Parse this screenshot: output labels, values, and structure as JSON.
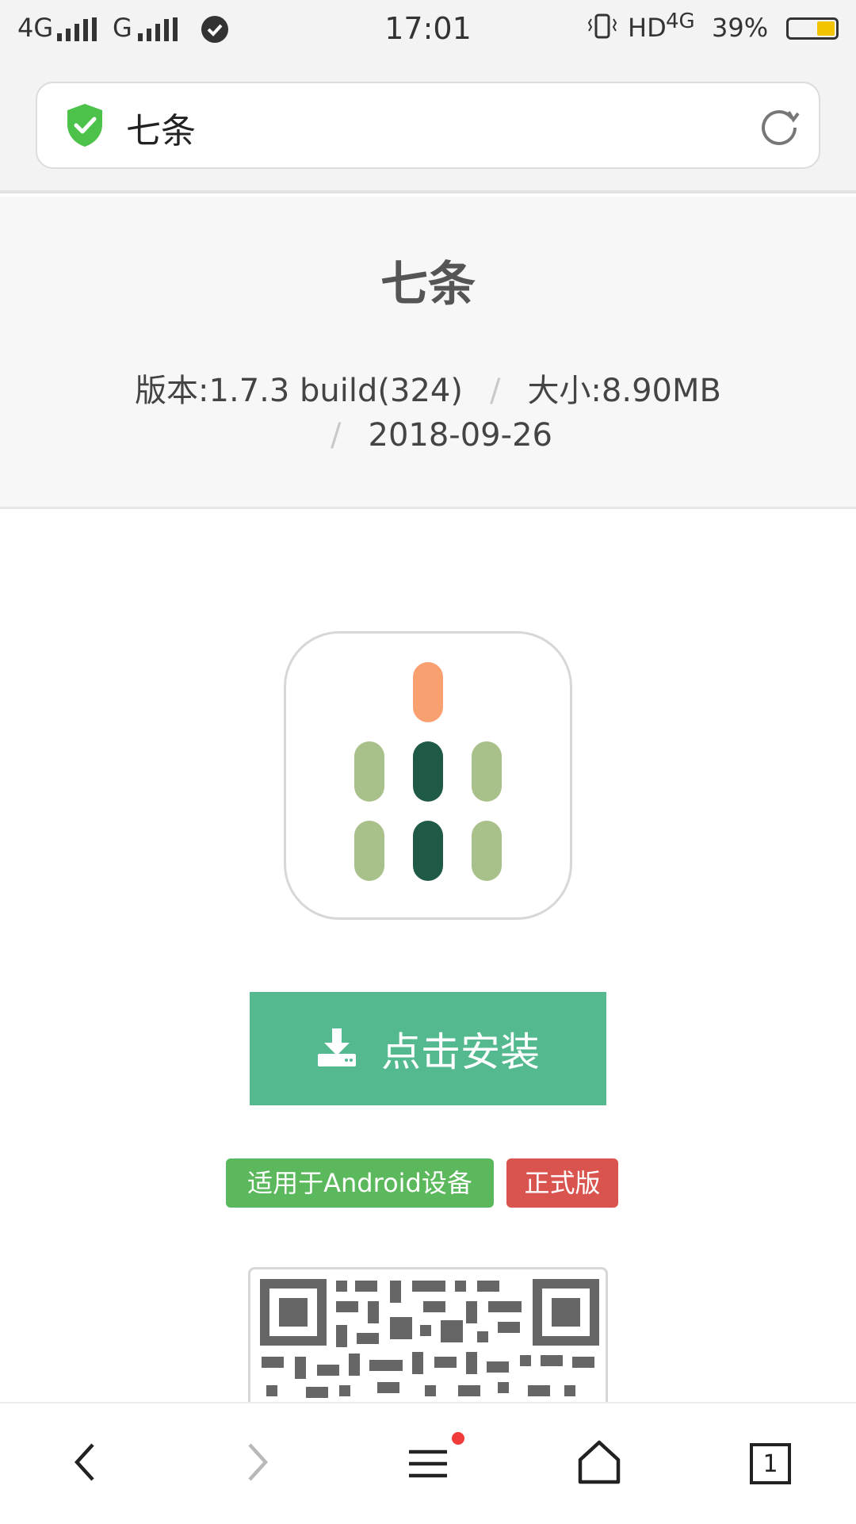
{
  "status_bar": {
    "left": "4G",
    "network2": "G",
    "time": "17:01",
    "hd": "HD",
    "network_right": "4G",
    "battery": "39%"
  },
  "address_bar": {
    "url_text": "七条",
    "secure_icon": "shield-check-icon",
    "reload_icon": "reload-icon"
  },
  "app": {
    "title": "七条",
    "version": "版本:1.7.3 build(324)",
    "size": "大小:8.90MB",
    "date": "2018-09-26",
    "separator": "/"
  },
  "install": {
    "label": "点击安装",
    "icon": "download-icon"
  },
  "badges": {
    "platform": "适用于Android设备",
    "release": "正式版"
  },
  "bottom_nav": {
    "tab_count": "1",
    "icons": [
      "back-icon",
      "forward-icon",
      "menu-icon",
      "home-icon",
      "tabs-icon"
    ]
  },
  "colors": {
    "install_green": "#55b990",
    "badge_green": "#5cb85c",
    "badge_red": "#d9534f",
    "icon_orange": "#f9a070",
    "icon_light_green": "#a8c08a",
    "icon_dark_green": "#1e5a46"
  }
}
